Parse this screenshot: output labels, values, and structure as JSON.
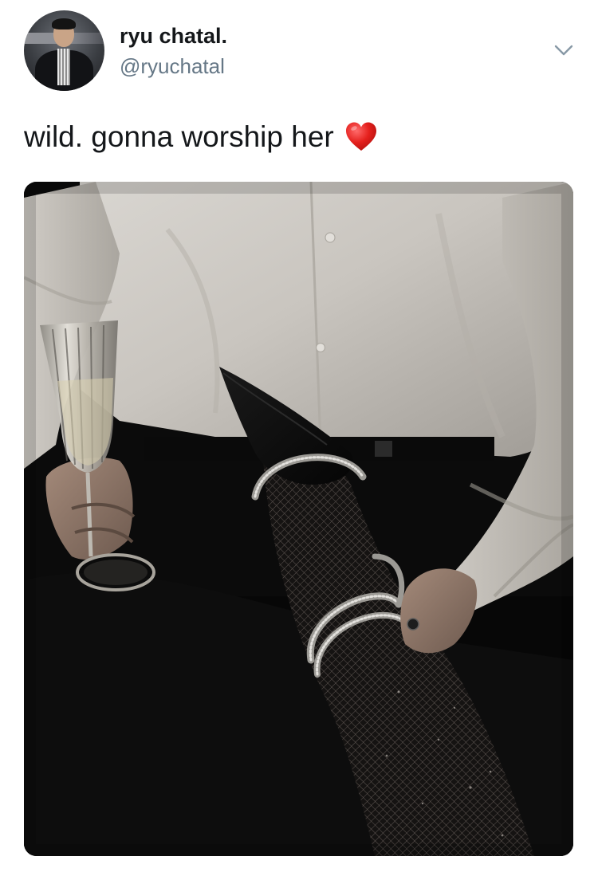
{
  "tweet": {
    "author": {
      "display_name": "ryu chatal.",
      "handle": "@ryuchatal",
      "avatar_icon": "profile-photo"
    },
    "text": "wild. gonna worship her",
    "emoji": "heart-emoji",
    "emoji_color": "#e0245e",
    "menu_icon": "chevron-down-icon",
    "media": {
      "kind": "photo",
      "description_icon": "attached-photo"
    }
  },
  "colors": {
    "text": "#14171a",
    "secondary_text": "#657786",
    "caret": "#8899a6"
  }
}
